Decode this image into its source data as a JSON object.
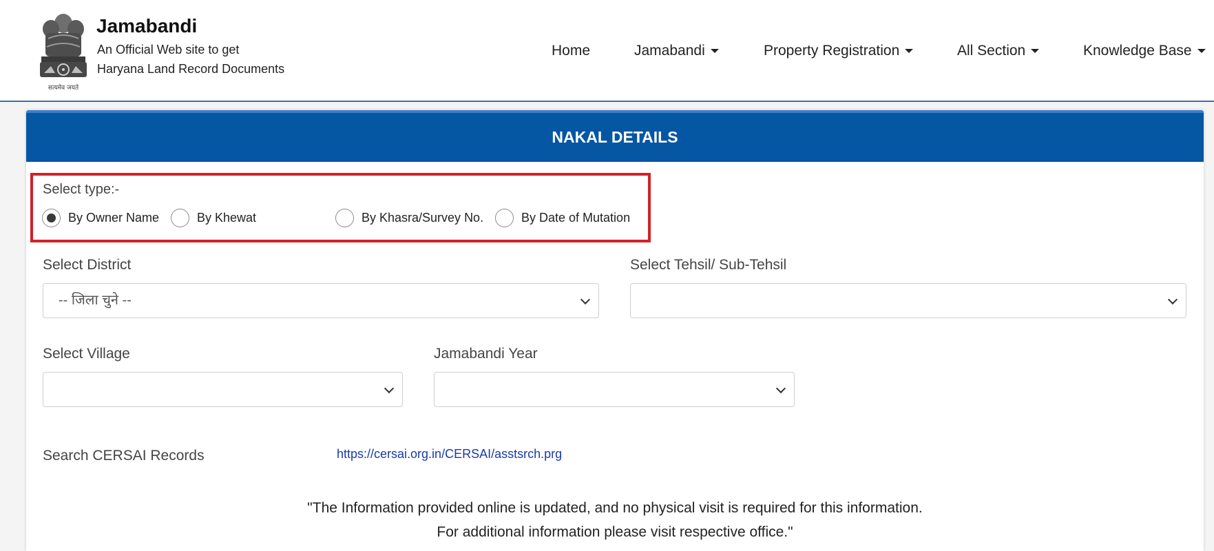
{
  "brand": {
    "title": "Jamabandi",
    "subtitle_line1": "An Official Web site to get",
    "subtitle_line2": "Haryana Land Record Documents",
    "emblem_motto": "सत्यमेव जयते"
  },
  "nav": {
    "items": [
      {
        "label": "Home",
        "dropdown": false
      },
      {
        "label": "Jamabandi",
        "dropdown": true
      },
      {
        "label": "Property Registration",
        "dropdown": true
      },
      {
        "label": "All Section",
        "dropdown": true
      },
      {
        "label": "Knowledge Base",
        "dropdown": true
      }
    ]
  },
  "panel": {
    "heading": "NAKAL DETAILS"
  },
  "select_type": {
    "label": "Select type:-",
    "options": [
      {
        "label": "By Owner Name",
        "checked": true
      },
      {
        "label": "By Khewat",
        "checked": false
      },
      {
        "label": "By Khasra/Survey No.",
        "checked": false
      },
      {
        "label": "By Date of Mutation",
        "checked": false
      }
    ]
  },
  "fields": {
    "district": {
      "label": "Select District",
      "value": "-- जिला चुने --"
    },
    "tehsil": {
      "label": "Select Tehsil/ Sub-Tehsil",
      "value": ""
    },
    "village": {
      "label": "Select Village",
      "value": ""
    },
    "year": {
      "label": "Jamabandi Year",
      "value": ""
    }
  },
  "cersai": {
    "label": "Search CERSAI Records",
    "link": "https://cersai.org.in/CERSAI/asstsrch.prg"
  },
  "notice": {
    "line1": "\"The Information provided online is updated, and no physical visit is required for this information.",
    "line2": "For additional information please visit respective office.\""
  },
  "colors": {
    "header_bar": "#0556a3",
    "highlight_border": "#d32027",
    "link": "#1a3aa8"
  }
}
